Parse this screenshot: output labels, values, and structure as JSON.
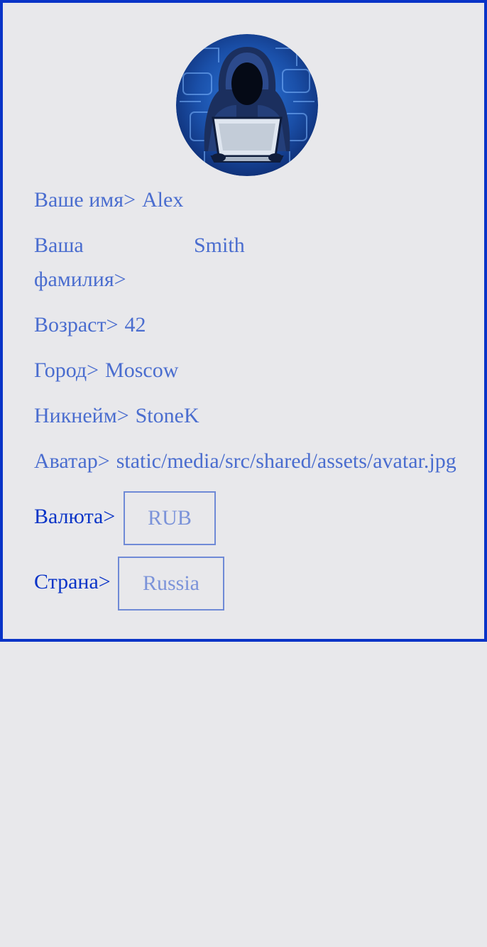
{
  "profile": {
    "first_name_label": "Ваше имя>",
    "first_name": "Alex",
    "last_name_label": "Ваша фамилия>",
    "last_name": "Smith",
    "age_label": "Возраст>",
    "age": "42",
    "city_label": "Город>",
    "city": "Moscow",
    "nickname_label": "Никнейм>",
    "nickname": "StoneK",
    "avatar_label": "Аватар>",
    "avatar_path": "static/media/src/shared/assets/avatar.jpg",
    "currency_label": "Валюта>",
    "currency": "RUB",
    "country_label": "Страна>",
    "country": "Russia"
  },
  "colors": {
    "border": "#0a34c7",
    "text": "#4a6dcf",
    "label_dark": "#0a34c7",
    "select_text": "#7b93d9",
    "background": "#e8e8eb"
  },
  "icons": {
    "avatar": "hooded-hacker-with-laptop"
  }
}
